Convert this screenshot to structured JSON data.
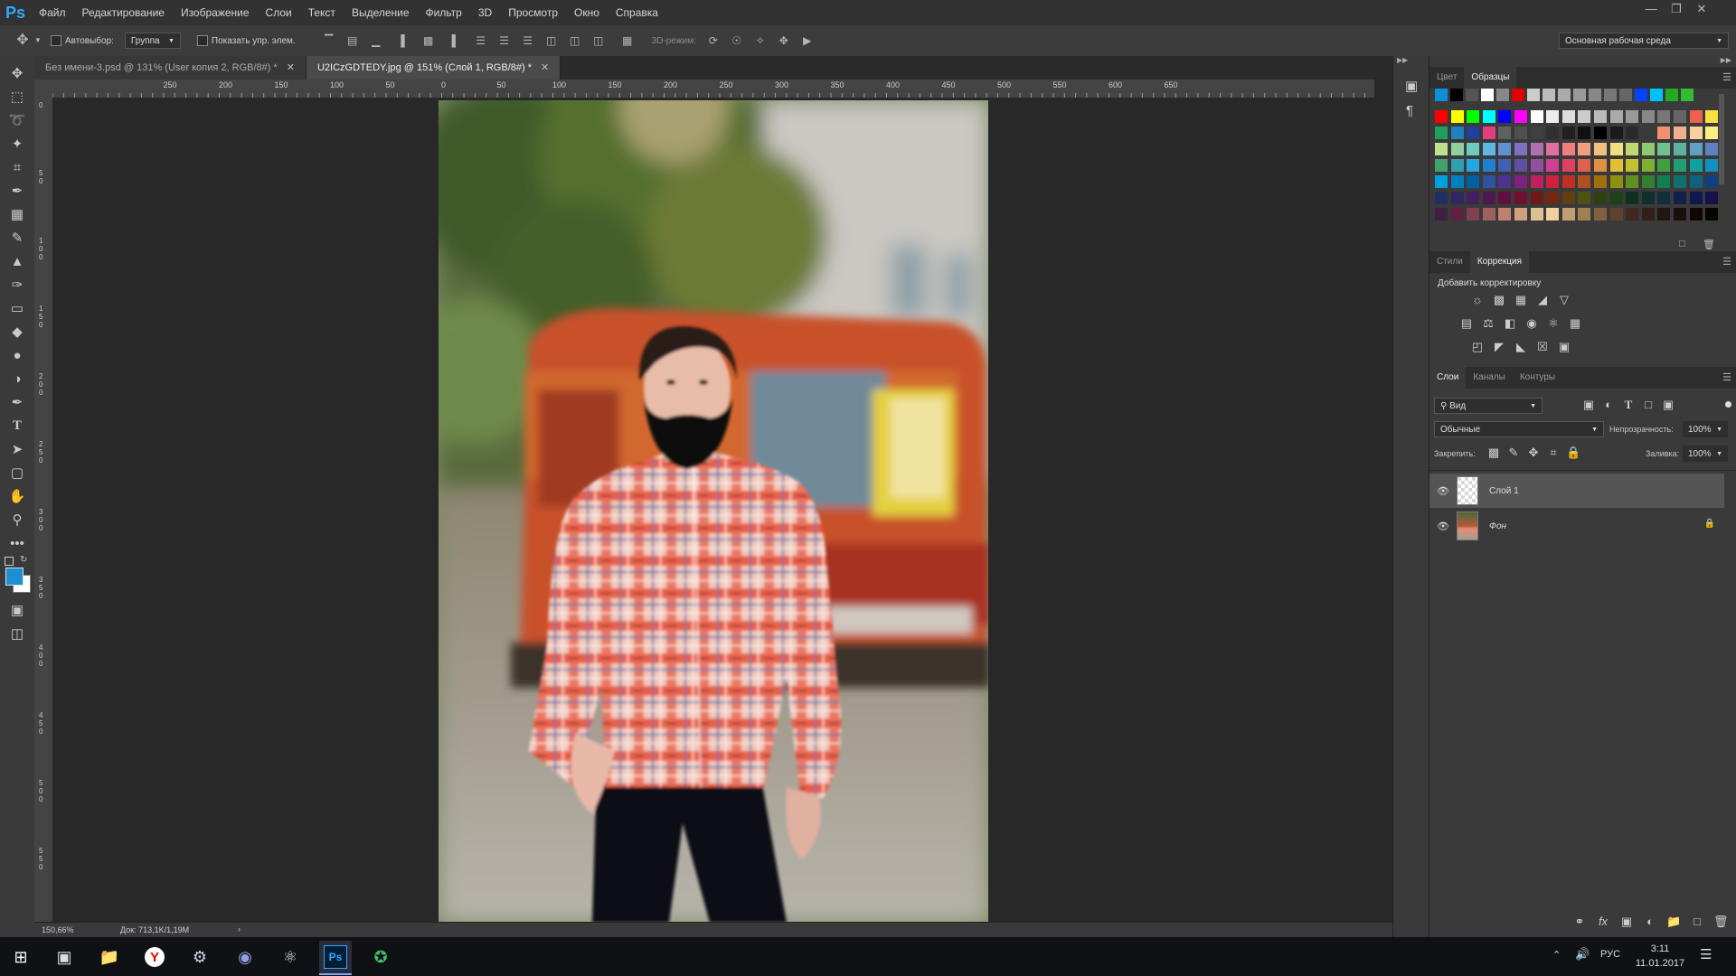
{
  "app": {
    "logo": "Ps"
  },
  "menu": [
    "Файл",
    "Редактирование",
    "Изображение",
    "Слои",
    "Текст",
    "Выделение",
    "Фильтр",
    "3D",
    "Просмотр",
    "Окно",
    "Справка"
  ],
  "options": {
    "autoselect_label": "Автовыбор:",
    "autoselect_value": "Группа",
    "show_controls_label": "Показать упр. элем.",
    "mode3d_label": "3D-режим:",
    "workspace": "Основная рабочая среда"
  },
  "tabs": [
    {
      "label": "Без имени-3.psd @ 131% (User копия 2, RGB/8#) *",
      "active": false
    },
    {
      "label": "U2ICzGDTEDY.jpg @ 151% (Слой 1, RGB/8#) *",
      "active": true
    }
  ],
  "ruler_top": [
    "250",
    "200",
    "150",
    "100",
    "50",
    "0",
    "50",
    "100",
    "150",
    "200",
    "250",
    "300",
    "350",
    "400",
    "450",
    "500",
    "550",
    "600",
    "650"
  ],
  "ruler_left": [
    "0",
    "5 0",
    "1 0 0",
    "1 5 0",
    "2 0 0",
    "2 5 0",
    "3 0 0",
    "3 5 0",
    "4 0 0",
    "4 5 0",
    "5 0 0",
    "5 5 0"
  ],
  "status": {
    "zoom": "150,66%",
    "doc": "Док: 713,1K/1,19M"
  },
  "swatches_panel": {
    "tabs": [
      "Цвет",
      "Образцы"
    ],
    "active": 1
  },
  "adjust_panel": {
    "tabs": [
      "Стили",
      "Коррекция"
    ],
    "active": 1,
    "title": "Добавить корректировку"
  },
  "layers_panel": {
    "tabs": [
      "Слои",
      "Каналы",
      "Контуры"
    ],
    "active": 0,
    "filter": "Вид",
    "blend": "Обычные",
    "opacity_label": "Непрозрачность:",
    "opacity": "100%",
    "lock_label": "Закрепить:",
    "fill_label": "Заливка:",
    "fill": "100%",
    "layers": [
      {
        "name": "Слой 1",
        "selected": true,
        "locked": false
      },
      {
        "name": "Фон",
        "selected": false,
        "locked": true
      }
    ]
  },
  "taskbar": {
    "lang": "РУС",
    "time": "3:11",
    "date": "11.01.2017"
  },
  "colors": {
    "foreground": "#1e8fd6",
    "background": "#ffffff",
    "accent": "#31a8ff"
  }
}
